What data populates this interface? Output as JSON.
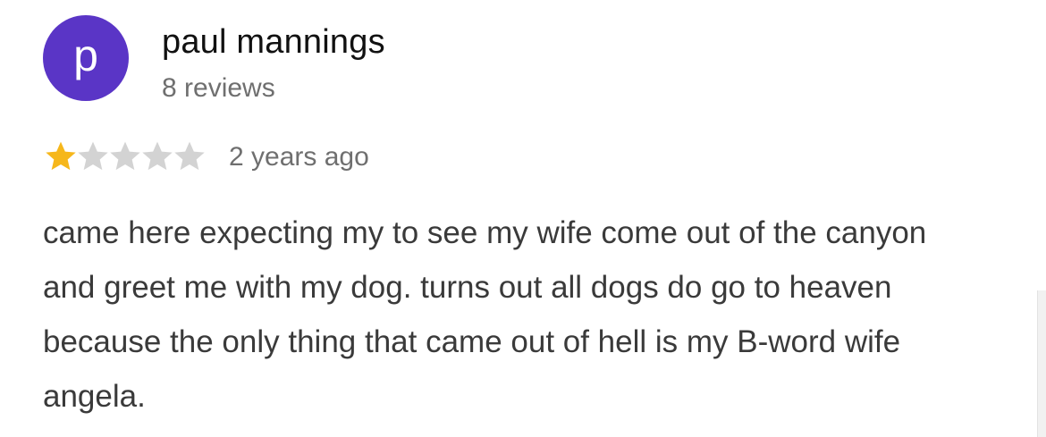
{
  "review": {
    "avatar": {
      "letter": "p",
      "color": "#5a35c6"
    },
    "author_name": "paul mannings",
    "review_count": "8 reviews",
    "rating": 1,
    "max_rating": 5,
    "star_filled_color": "#f6b71b",
    "star_empty_color": "#d3d3d3",
    "time_ago": "2 years ago",
    "text": "came here expecting my to see my wife come out of the canyon and greet me with my dog. turns out all dogs do go to heaven because the only thing that came out of hell is my B-word wife angela."
  }
}
